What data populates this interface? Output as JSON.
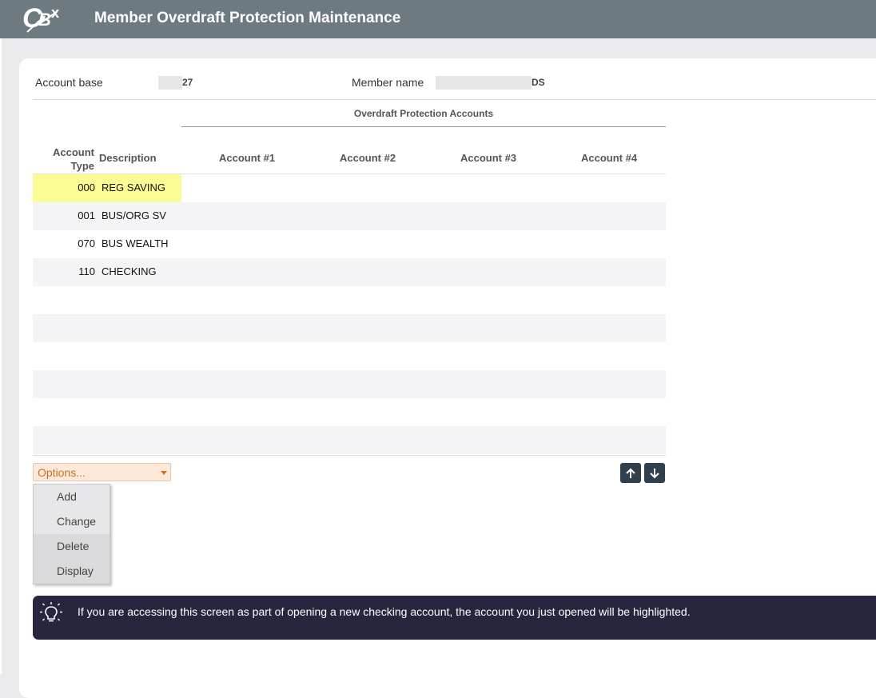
{
  "header": {
    "logo_text": "CBX",
    "title": "Member Overdraft Protection Maintenance"
  },
  "info_fields": {
    "account_base_label": "Account base",
    "account_base_value": "27",
    "member_name_label": "Member name",
    "member_name_value": "DS"
  },
  "table": {
    "group_title": "Overdraft Protection Accounts",
    "headers": {
      "account_type_line1": "Account",
      "account_type_line2": "Type",
      "description": "Description",
      "account1": "Account  #1",
      "account2": "Account  #2",
      "account3": "Account  #3",
      "account4": "Account  #4"
    },
    "rows": [
      {
        "type": "000",
        "description": "REG SAVING",
        "highlighted": true
      },
      {
        "type": "001",
        "description": "BUS/ORG SV"
      },
      {
        "type": "070",
        "description": "BUS WEALTH"
      },
      {
        "type": "110",
        "description": "CHECKING"
      },
      {
        "type": "",
        "description": ""
      },
      {
        "type": "",
        "description": ""
      },
      {
        "type": "",
        "description": ""
      },
      {
        "type": "",
        "description": ""
      },
      {
        "type": "",
        "description": ""
      },
      {
        "type": "",
        "description": ""
      }
    ]
  },
  "options": {
    "placeholder": "Options...",
    "items": [
      "Add",
      "Change",
      "Delete",
      "Display"
    ]
  },
  "info_banner": {
    "message": "If you are accessing this screen as part of opening a new checking account, the account you just opened will be highlighted."
  },
  "colors": {
    "header_bg": "#6d7b80",
    "highlight": "#fbfb94",
    "banner_bg": "#26263f",
    "options_text": "#c9711e"
  }
}
